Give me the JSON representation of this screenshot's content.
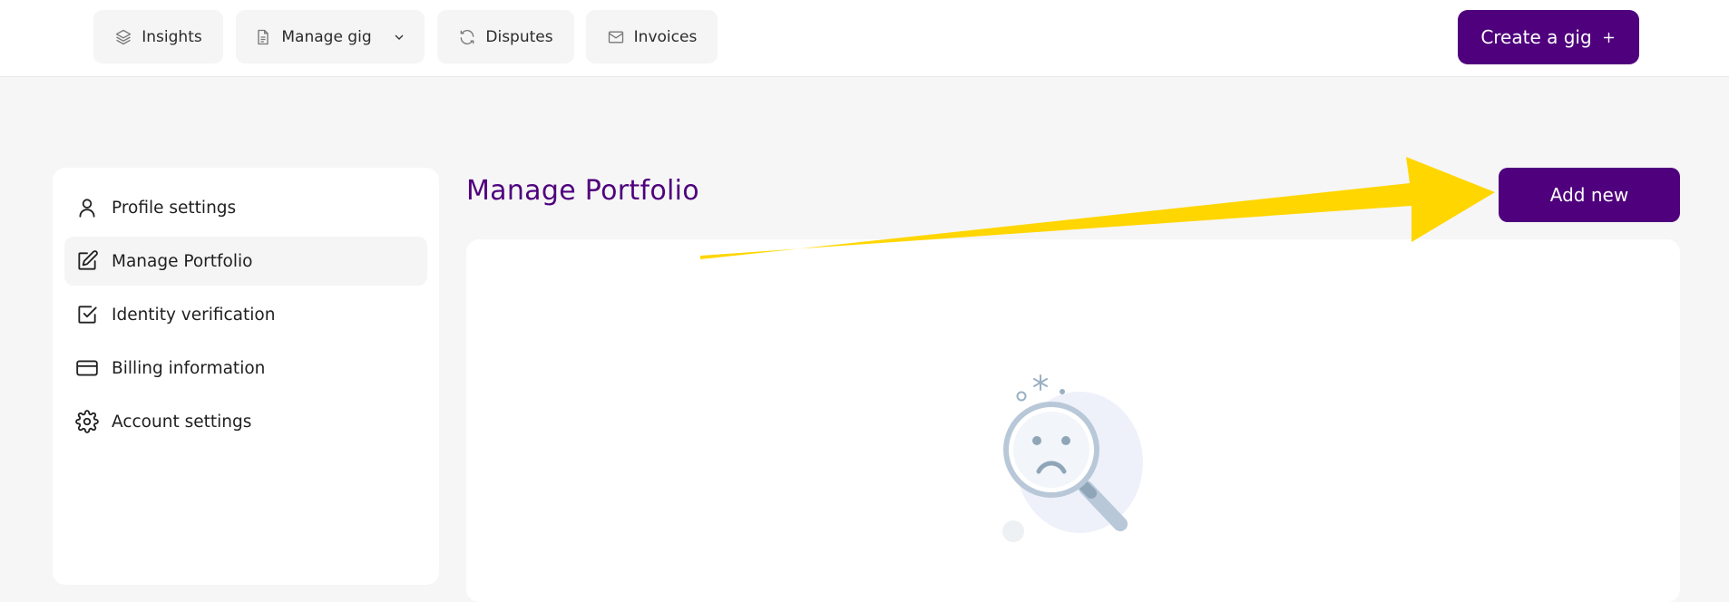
{
  "topnav": {
    "items": [
      {
        "label": "Insights",
        "icon": "layers-icon"
      },
      {
        "label": "Manage gig",
        "icon": "document-icon",
        "dropdown": true
      },
      {
        "label": "Disputes",
        "icon": "refresh-icon"
      },
      {
        "label": "Invoices",
        "icon": "mail-icon"
      }
    ],
    "create_label": "Create a gig",
    "create_icon": "plus-icon"
  },
  "sidebar": {
    "items": [
      {
        "label": "Profile settings",
        "icon": "user-icon"
      },
      {
        "label": "Manage Portfolio",
        "icon": "edit-icon",
        "active": true
      },
      {
        "label": "Identity verification",
        "icon": "checkbox-icon"
      },
      {
        "label": "Billing information",
        "icon": "credit-card-icon"
      },
      {
        "label": "Account settings",
        "icon": "gear-icon"
      }
    ]
  },
  "main": {
    "title": "Manage Portfolio",
    "add_label": "Add new",
    "empty_state_icon": "sad-magnifier-icon"
  },
  "colors": {
    "brand": "#4f007d",
    "annotation_arrow": "#ffd600",
    "background": "#f6f6f6"
  }
}
